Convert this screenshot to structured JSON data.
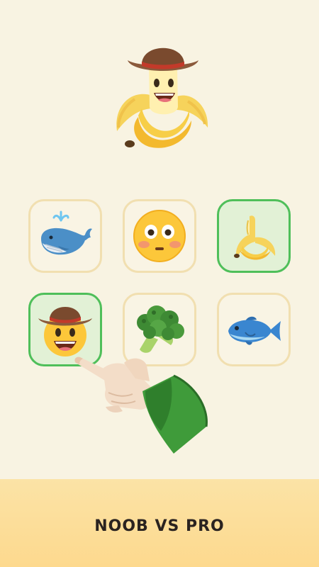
{
  "result": {
    "icon": "cowboy-banana-emoji"
  },
  "tiles": [
    {
      "icon": "whale-emoji",
      "selected": false
    },
    {
      "icon": "flushed-face-emoji",
      "selected": false
    },
    {
      "icon": "banana-emoji",
      "selected": true
    },
    {
      "icon": "cowboy-face-emoji",
      "selected": true
    },
    {
      "icon": "broccoli-emoji",
      "selected": false
    },
    {
      "icon": "fish-emoji",
      "selected": false
    }
  ],
  "hand": {
    "icon": "pointing-hand-icon"
  },
  "footer": {
    "title": "NOOB VS PRO"
  },
  "colors": {
    "background": "#f8f3e2",
    "tile_border": "#f1dfb0",
    "selected_border": "#4fbf5a",
    "selected_fill": "#e2f1d6",
    "footer": "#fde0a0"
  }
}
